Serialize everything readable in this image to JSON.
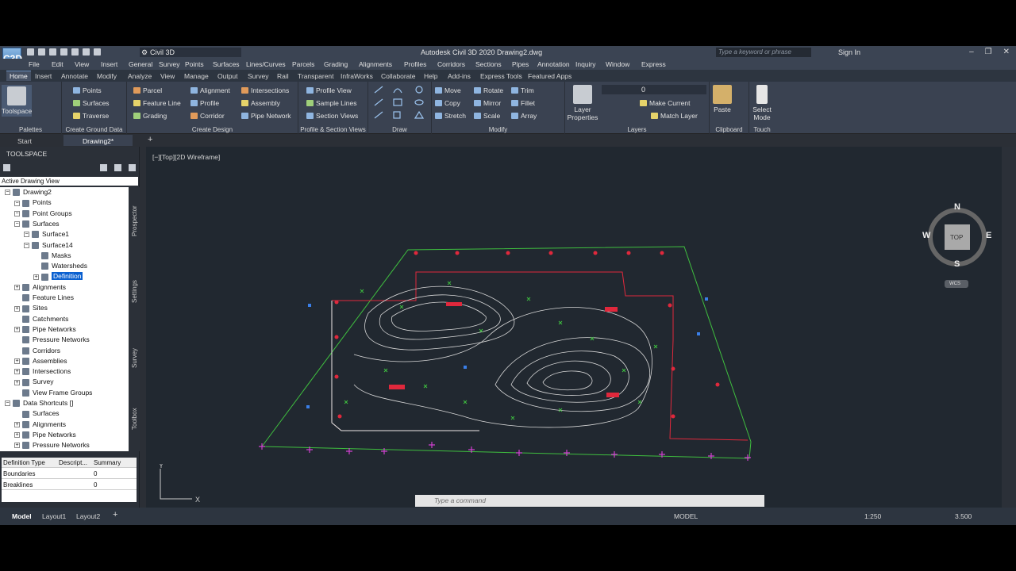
{
  "titlebar": {
    "logo": "C3D",
    "workspace": "Civil 3D",
    "title": "Autodesk Civil 3D 2020   Drawing2.dwg",
    "search_placeholder": "Type a keyword or phrase",
    "signin": "Sign In"
  },
  "menu": [
    "File",
    "Edit",
    "View",
    "Insert",
    "General",
    "Survey",
    "Points",
    "Surfaces",
    "Lines/Curves",
    "Parcels",
    "Grading",
    "Alignments",
    "Profiles",
    "Corridors",
    "Sections",
    "Pipes",
    "Annotation",
    "Inquiry",
    "Window",
    "Express"
  ],
  "tabs": [
    "Home",
    "Insert",
    "Annotate",
    "Modify",
    "Analyze",
    "View",
    "Manage",
    "Output",
    "Survey",
    "Rail",
    "Transparent",
    "InfraWorks",
    "Collaborate",
    "Help",
    "Add-ins",
    "Express Tools",
    "Featured Apps"
  ],
  "ribbon": {
    "palettes": {
      "label": "Palettes",
      "toolspace": "Toolspace"
    },
    "ground": {
      "label": "Create Ground Data",
      "items": [
        "Points",
        "Surfaces",
        "Traverse"
      ]
    },
    "design": {
      "label": "Create Design",
      "items": [
        "Parcel",
        "Feature Line",
        "Grading",
        "Alignment",
        "Profile",
        "Corridor",
        "Intersections",
        "Assembly",
        "Pipe Network"
      ]
    },
    "profile": {
      "label": "Profile & Section Views",
      "items": [
        "Profile View",
        "Sample Lines",
        "Section Views"
      ]
    },
    "draw": {
      "label": "Draw"
    },
    "modify": {
      "label": "Modify",
      "items": [
        "Move",
        "Copy",
        "Stretch",
        "Rotate",
        "Mirror",
        "Scale",
        "Trim",
        "Fillet",
        "Array"
      ]
    },
    "layers": {
      "label": "Layers",
      "layer_props": "Layer Properties",
      "current_layer": "0",
      "make_current": "Make Current",
      "match_layer": "Match Layer"
    },
    "clipboard": {
      "label": "Clipboard",
      "paste": "Paste"
    },
    "touch": {
      "label": "Touch",
      "select_mode": "Select Mode"
    }
  },
  "doctabs": {
    "start": "Start",
    "drawing": "Drawing2*"
  },
  "toolspace": {
    "title": "TOOLSPACE",
    "view_select": "Active Drawing View",
    "tree": [
      "Drawing2",
      "Points",
      "Point Groups",
      "Surfaces",
      "Surface1",
      "Surface14",
      "Masks",
      "Watersheds",
      "Definition",
      "Alignments",
      "Feature Lines",
      "Sites",
      "Catchments",
      "Pipe Networks",
      "Pressure Networks",
      "Corridors",
      "Assemblies",
      "Intersections",
      "Survey",
      "View Frame Groups",
      "Data Shortcuts []",
      "Surfaces",
      "Alignments",
      "Pipe Networks",
      "Pressure Networks"
    ],
    "vtabs": [
      "Prospector",
      "Settings",
      "Survey",
      "Toolbox"
    ],
    "grid_headers": [
      "Definition Type",
      "Descript...",
      "Summary"
    ],
    "grid_rows": [
      [
        "Boundaries",
        "",
        "0"
      ],
      [
        "Breaklines",
        "",
        "0"
      ]
    ]
  },
  "viewport": {
    "label": "[−][Top][2D Wireframe]",
    "compass": {
      "n": "N",
      "s": "S",
      "e": "E",
      "w": "W",
      "top": "TOP",
      "wcs": "WCS"
    }
  },
  "command": {
    "placeholder": "Type a command"
  },
  "status": {
    "model": "MODEL",
    "scale": "1:250",
    "lineweight": "3.500"
  },
  "layout_tabs": [
    "Model",
    "Layout1",
    "Layout2"
  ],
  "colors": {
    "ui_dark": "#2b2f36",
    "ribbon": "#3a4251",
    "accent": "#0a60d0",
    "drawing_red": "#e0283c",
    "drawing_green": "#3fbf3f",
    "contour": "#d8d8d8"
  }
}
